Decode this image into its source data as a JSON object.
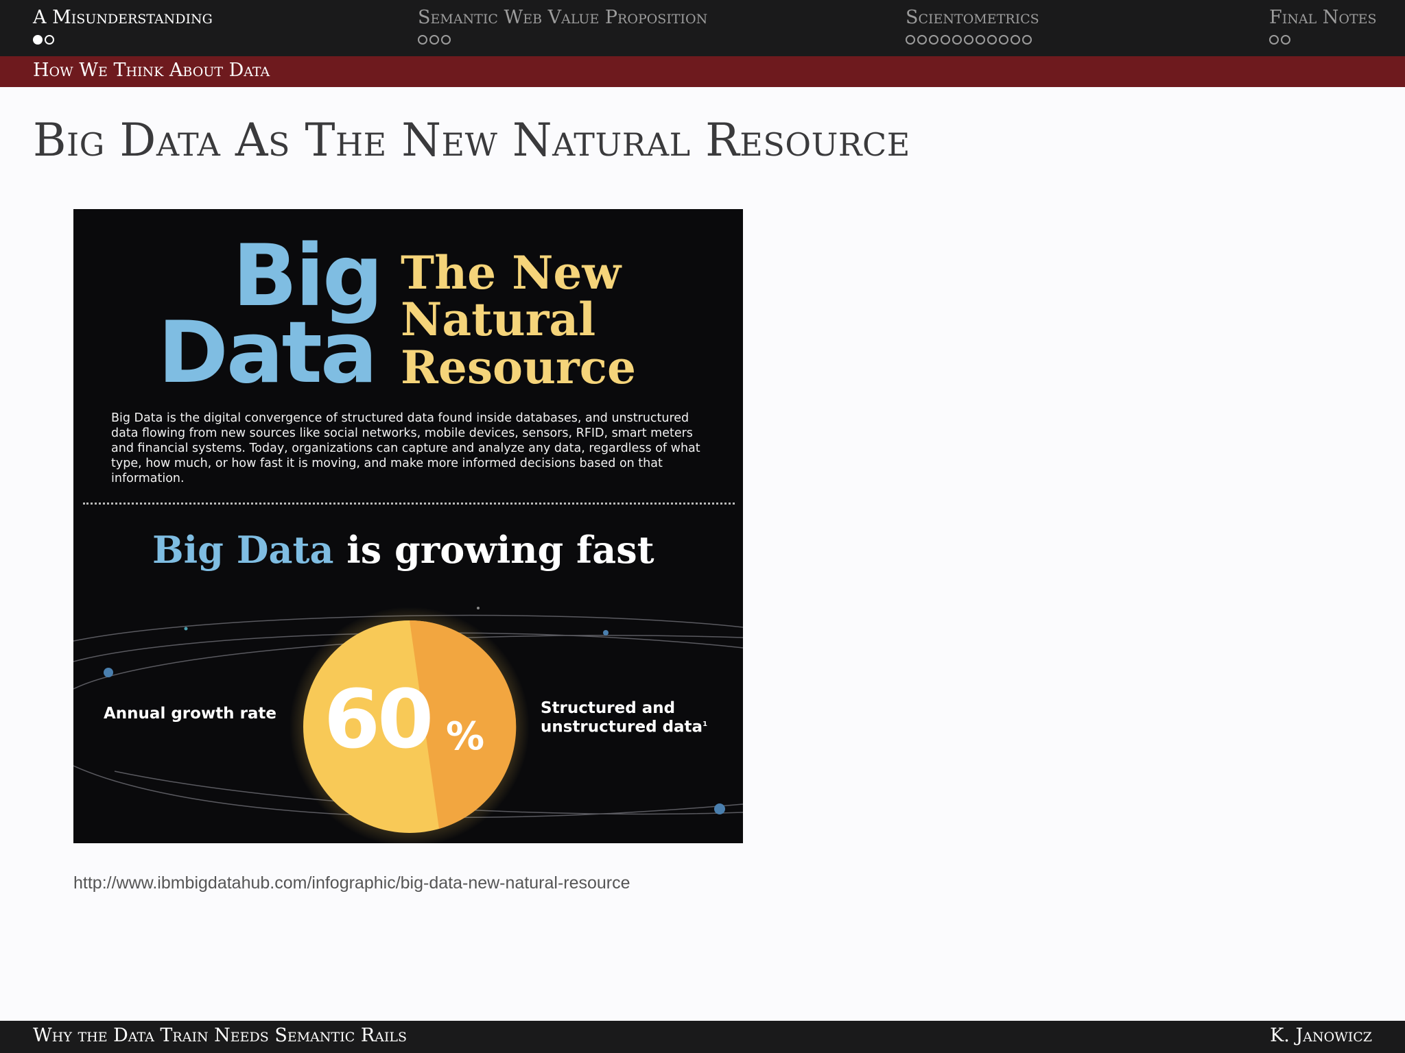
{
  "nav": {
    "sections": [
      {
        "title": "A Misunderstanding",
        "dots": 2,
        "filled": 1
      },
      {
        "title": "Semantic Web Value Proposition",
        "dots": 3,
        "filled": 0
      },
      {
        "title": "Scientometrics",
        "dots": 11,
        "filled": 0
      },
      {
        "title": "Final Notes",
        "dots": 2,
        "filled": 0
      }
    ],
    "active_section": 0
  },
  "subsection": "How We Think About Data",
  "slide_title": "Big Data As The New Natural Resource",
  "infographic": {
    "big_word_1": "Big",
    "big_word_2": "Data",
    "subtitle_1": "The New",
    "subtitle_2": "Natural",
    "subtitle_3": "Resource",
    "description": "Big Data is the digital convergence of structured data found inside databases, and unstructured data flowing from new sources like social networks, mobile devices, sensors, RFID, smart meters and financial systems. Today, organizations can capture and analyze any data, regardless of what type, how much, or how fast it is moving, and make more informed decisions based on that information.",
    "growing_blue": "Big Data",
    "growing_white": "is growing fast",
    "left_label": "Annual growth rate",
    "percent_value": "60",
    "percent_sign": "%",
    "right_label_1": "Structured and",
    "right_label_2": "unstructured data",
    "footnote": "1",
    "colors": {
      "blue": "#7fbde2",
      "yellow": "#f5d47a",
      "sun_light": "#f8c957",
      "sun_dark": "#f2a640"
    }
  },
  "source_url": "http://www.ibmbigdatahub.com/infographic/big-data-new-natural-resource",
  "footer": {
    "left": "Why the Data Train Needs Semantic Rails",
    "right": "K. Janowicz"
  }
}
